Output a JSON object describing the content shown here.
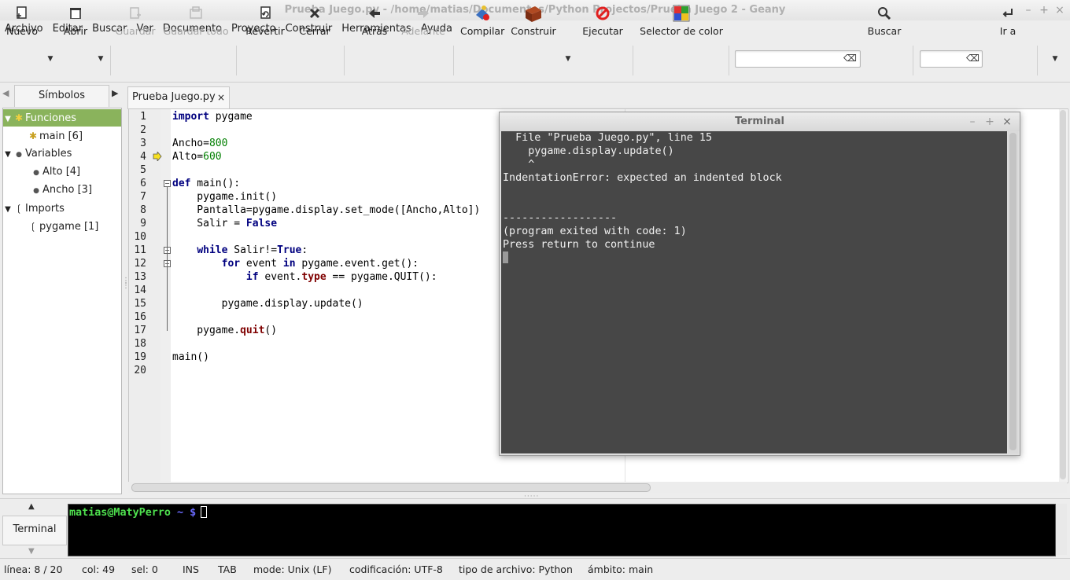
{
  "window": {
    "title": "Prueba Juego.py - /home/matias/Documentos/Python Projectos/Prueba Juego 2 - Geany"
  },
  "menu": [
    "Archivo",
    "Editar",
    "Buscar",
    "Ver",
    "Documento",
    "Proyecto",
    "Construir",
    "Herramientas",
    "Ayuda"
  ],
  "toolbar": {
    "nuevo": "Nuevo",
    "abrir": "Abrir",
    "guardar": "Guardar",
    "guardar_todo": "Guardar todo",
    "revertir": "Revertir",
    "cerrar": "Cerrar",
    "atras": "Atrás",
    "adelante": "Adelante",
    "compilar": "Compilar",
    "construir": "Construir",
    "ejecutar": "Ejecutar",
    "selector_color": "Selector de color",
    "buscar": "Buscar",
    "ir_a": "Ir a",
    "search_value": "",
    "goto_value": ""
  },
  "sidebar": {
    "tab_label": "Símbolos",
    "tree": [
      {
        "label": "Funciones",
        "level": 0
      },
      {
        "label": "main [6]",
        "level": 1
      },
      {
        "label": "Variables",
        "level": 0
      },
      {
        "label": "Alto [4]",
        "level": 1
      },
      {
        "label": "Ancho [3]",
        "level": 1
      },
      {
        "label": "Imports",
        "level": 0
      },
      {
        "label": "pygame [1]",
        "level": 1
      }
    ]
  },
  "editor": {
    "tab_label": "Prueba Juego.py",
    "line_numbers": [
      "1",
      "2",
      "3",
      "4",
      "5",
      "6",
      "7",
      "8",
      "9",
      "10",
      "11",
      "12",
      "13",
      "14",
      "15",
      "16",
      "17",
      "18",
      "19",
      "20"
    ],
    "code": {
      "l1_kw": "import",
      "l1_rest": " pygame",
      "l3_a": "Ancho=",
      "l3_n": "800",
      "l4_a": "Alto=",
      "l4_n": "600",
      "l6_kw": "def",
      "l6_rest": " main():",
      "l7": "    pygame.init()",
      "l8": "    Pantalla=pygame.display.set_mode([Ancho,Alto])",
      "l9_a": "    Salir = ",
      "l9_kw": "False",
      "l11_a": "    ",
      "l11_kw": "while",
      "l11_b": " Salir!=",
      "l11_kw2": "True",
      "l11_c": ":",
      "l12_a": "        ",
      "l12_kw": "for",
      "l12_b": " event ",
      "l12_kw2": "in",
      "l12_c": " pygame.event.get():",
      "l13_a": "            ",
      "l13_kw": "if",
      "l13_b": " event.",
      "l13_kw2": "type",
      "l13_c": " == pygame.QUIT():",
      "l15": "        pygame.display.update()",
      "l17_a": "    pygame.",
      "l17_kw": "quit",
      "l17_b": "()",
      "l19": "main()"
    }
  },
  "terminal_window": {
    "title": "Terminal",
    "lines": [
      "  File \"Prueba Juego.py\", line 15",
      "    pygame.display.update()",
      "    ^",
      "IndentationError: expected an indented block",
      "",
      "",
      "------------------",
      "(program exited with code: 1)",
      "Press return to continue"
    ]
  },
  "bottom_panel": {
    "tab_label": "Terminal",
    "prompt_user": "matias@MatyPerro",
    "prompt_path": " ~ $ "
  },
  "statusbar": {
    "line": "línea: 8 / 20",
    "col": "col: 49",
    "sel": "sel: 0",
    "ins": "INS",
    "tab": "TAB",
    "mode": "mode: Unix (LF)",
    "encoding": "codificación: UTF-8",
    "filetype": "tipo de archivo: Python",
    "scope": "ámbito: main"
  },
  "colors": {
    "accent_selected": "#8ab35c",
    "prompt_green": "#4ee04e",
    "prompt_blue": "#6b6bff"
  }
}
